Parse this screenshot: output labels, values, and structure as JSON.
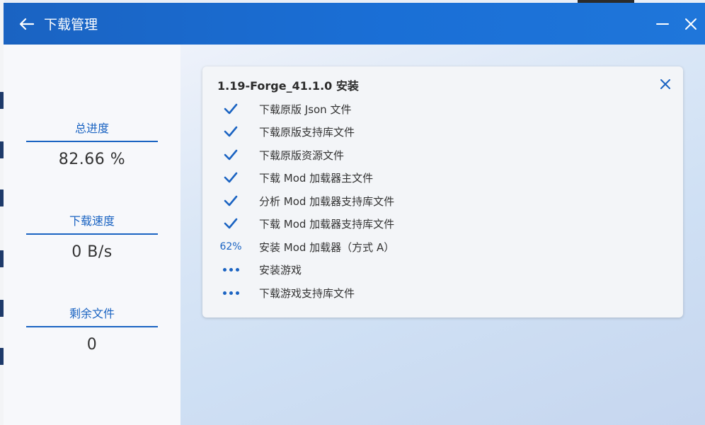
{
  "window": {
    "title": "下载管理"
  },
  "sidebar": {
    "stats": [
      {
        "label": "总进度",
        "value": "82.66 %"
      },
      {
        "label": "下载速度",
        "value": "0 B/s"
      },
      {
        "label": "剩余文件",
        "value": "0"
      }
    ]
  },
  "task": {
    "title": "1.19-Forge_41.1.0 安装",
    "steps": [
      {
        "status": "done",
        "label": "下载原版 Json 文件"
      },
      {
        "status": "done",
        "label": "下载原版支持库文件"
      },
      {
        "status": "done",
        "label": "下载原版资源文件"
      },
      {
        "status": "done",
        "label": "下载 Mod 加载器主文件"
      },
      {
        "status": "done",
        "label": "分析 Mod 加载器支持库文件"
      },
      {
        "status": "done",
        "label": "下载 Mod 加载器支持库文件"
      },
      {
        "status": "progress",
        "progress_text": "62%",
        "label": "安装 Mod 加载器（方式 A）"
      },
      {
        "status": "pending",
        "label": "安装游戏"
      },
      {
        "status": "pending",
        "label": "下载游戏支持库文件"
      }
    ]
  },
  "colors": {
    "accent": "#1a63c2",
    "titlebar": "#1a6fd6"
  }
}
